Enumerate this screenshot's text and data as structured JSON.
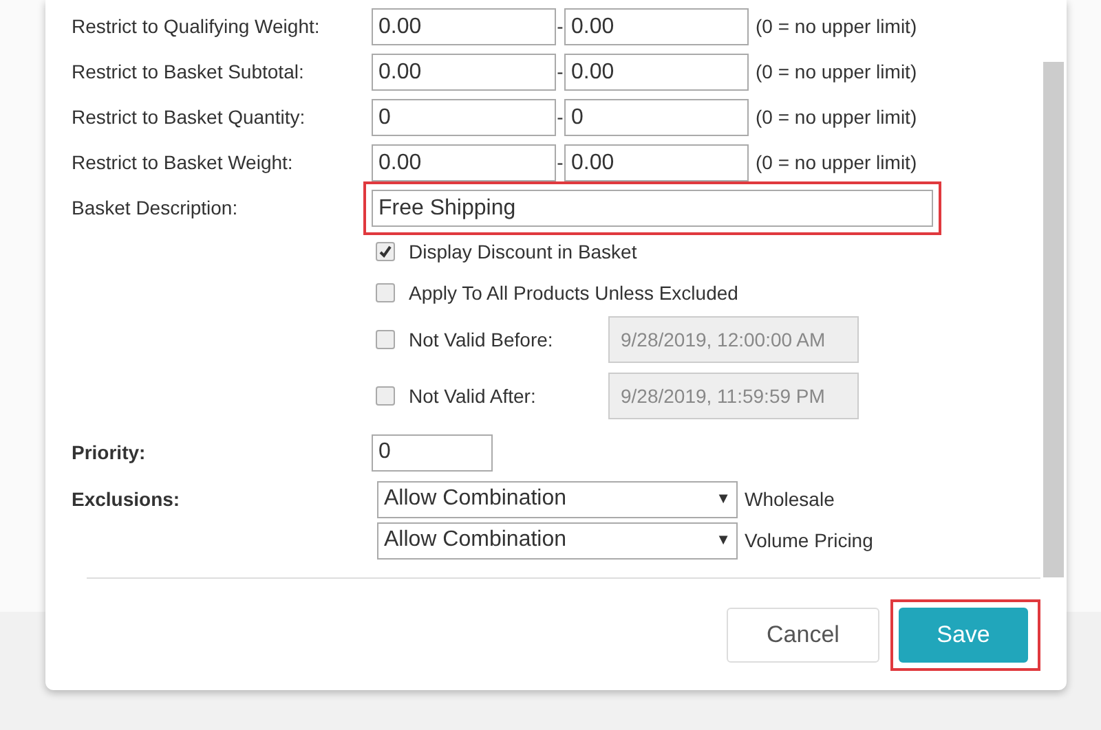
{
  "ranges": [
    {
      "label": "Restrict to Qualifying Weight:",
      "from": "0.00",
      "separator": "-",
      "to": "0.00",
      "note": "(0 = no upper limit)"
    },
    {
      "label": "Restrict to Basket Subtotal:",
      "from": "0.00",
      "separator": "-",
      "to": "0.00",
      "note": "(0 = no upper limit)"
    },
    {
      "label": "Restrict to Basket Quantity:",
      "from": "0",
      "separator": "-",
      "to": "0",
      "note": "(0 = no upper limit)"
    },
    {
      "label": "Restrict to Basket Weight:",
      "from": "0.00",
      "separator": "-",
      "to": "0.00",
      "note": "(0 = no upper limit)"
    }
  ],
  "description": {
    "label": "Basket Description:",
    "value": "Free Shipping",
    "highlighted": true
  },
  "options": [
    {
      "kind": "check",
      "label": "Display Discount in Basket",
      "checked": true
    },
    {
      "kind": "check",
      "label": "Apply To All Products Unless Excluded",
      "checked": false
    },
    {
      "kind": "date",
      "label": "Not Valid Before:",
      "checked": false,
      "value": "9/28/2019, 12:00:00 AM"
    },
    {
      "kind": "date",
      "label": "Not Valid After:",
      "checked": false,
      "value": "9/28/2019, 11:59:59 PM"
    }
  ],
  "priority": {
    "label": "Priority:",
    "value": "0"
  },
  "exclusions": {
    "label": "Exclusions:",
    "items": [
      {
        "value": "Allow Combination",
        "caret": "▼",
        "name": "Wholesale"
      },
      {
        "value": "Allow Combination",
        "caret": "▼",
        "name": "Volume Pricing"
      }
    ]
  },
  "buttons": [
    {
      "label": "Cancel",
      "kind": "secondary",
      "highlighted": false
    },
    {
      "label": "Save",
      "kind": "primary",
      "highlighted": true
    }
  ]
}
